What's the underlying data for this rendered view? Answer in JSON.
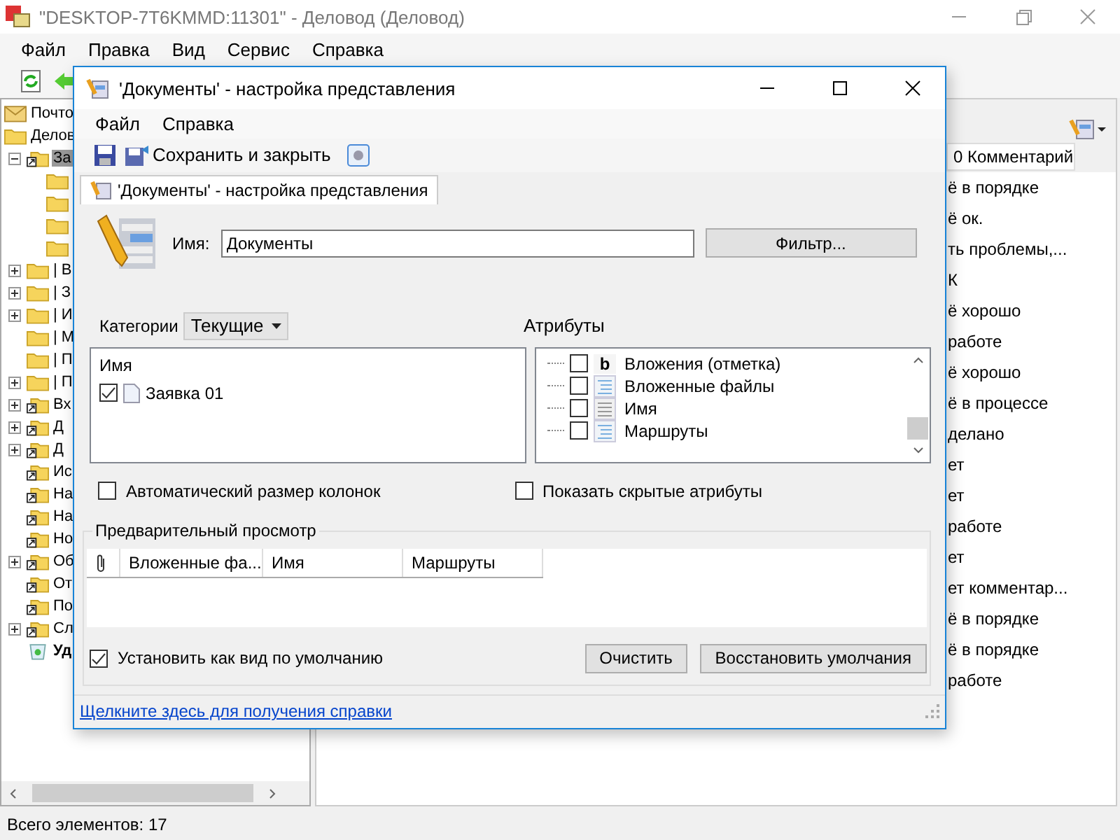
{
  "window": {
    "title": "\"DESKTOP-7T6KMMD:11301\" - Деловод (Деловод)"
  },
  "menu": [
    "Файл",
    "Правка",
    "Вид",
    "Сервис",
    "Справка"
  ],
  "tree": [
    {
      "label": "Почто",
      "kind": "mail",
      "selected": false
    },
    {
      "label": "Делов",
      "kind": "folder",
      "selected": false,
      "children": [
        {
          "label": "За",
          "kind": "shortcut",
          "selected": true,
          "expanded": true,
          "children": [
            {
              "kind": "folder"
            },
            {
              "kind": "folder"
            },
            {
              "kind": "folder"
            },
            {
              "kind": "folder"
            }
          ]
        },
        {
          "label": "| В",
          "kind": "folder",
          "selected": false,
          "expanded": false
        },
        {
          "label": "| З",
          "kind": "folder",
          "selected": false,
          "expanded": false
        },
        {
          "label": "| И",
          "kind": "folder",
          "selected": false,
          "expanded": false
        },
        {
          "label": "| М",
          "kind": "folder",
          "selected": false
        },
        {
          "label": "| П",
          "kind": "folder",
          "selected": false
        },
        {
          "label": "| П",
          "kind": "folder",
          "selected": false,
          "expanded": false
        },
        {
          "label": "Вх",
          "kind": "shortcut",
          "selected": false,
          "expanded": false
        },
        {
          "label": "Д",
          "kind": "shortcut",
          "selected": false,
          "expanded": false
        },
        {
          "label": "Д",
          "kind": "shortcut",
          "selected": false,
          "expanded": false
        },
        {
          "label": "Ис",
          "kind": "shortcut",
          "selected": false
        },
        {
          "label": "На",
          "kind": "shortcut",
          "selected": false
        },
        {
          "label": "На",
          "kind": "shortcut",
          "selected": false
        },
        {
          "label": "Но",
          "kind": "shortcut",
          "selected": false
        },
        {
          "label": "Об",
          "kind": "shortcut",
          "selected": false,
          "expanded": false
        },
        {
          "label": "От",
          "kind": "shortcut",
          "selected": false
        },
        {
          "label": "По",
          "kind": "shortcut",
          "selected": false
        },
        {
          "label": "Сл",
          "kind": "shortcut",
          "selected": false,
          "expanded": false
        },
        {
          "label": "Уд",
          "kind": "trash",
          "selected": false,
          "bold": true
        }
      ]
    }
  ],
  "list": {
    "column": "0 Комментарий",
    "rows": [
      "ё в порядке",
      "ё ок.",
      "ть проблемы,...",
      "К",
      "ё хорошо",
      "работе",
      "ё хорошо",
      "ё в процессе",
      "делано",
      "ет",
      "ет",
      "работе",
      "ет",
      "ет комментар...",
      "ё в порядке",
      "ё в порядке",
      "работе"
    ]
  },
  "status_bar": "Всего элементов: 17",
  "dialog": {
    "title": "'Документы' - настройка представления",
    "menu": [
      "Файл",
      "Справка"
    ],
    "save_close": "Сохранить и закрыть",
    "tab": {
      "label": "'Документы' - настройка представления",
      "selected": true
    },
    "name_label": "Имя:",
    "name_value": "Документы",
    "filter_button": "Фильтр...",
    "categories_label": "Категории",
    "categories_value": "Текущие",
    "attributes_label": "Атрибуты",
    "columns_list": {
      "header": "Имя",
      "items": [
        {
          "label": "Заявка 01",
          "checked": true
        }
      ]
    },
    "attributes": [
      {
        "label": "Вложения (отметка)",
        "checked": false,
        "kind": "glyph",
        "glyph": "b"
      },
      {
        "label": "Вложенные файлы",
        "checked": false,
        "kind": "list"
      },
      {
        "label": "Имя",
        "checked": false,
        "kind": "field"
      },
      {
        "label": "Маршруты",
        "checked": false,
        "kind": "list"
      }
    ],
    "auto_size": {
      "label": "Автоматический размер колонок",
      "checked": false
    },
    "show_hidden": {
      "label": "Показать скрытые атрибуты",
      "checked": false
    },
    "preview": {
      "title": "Предварительный просмотр",
      "columns": [
        {
          "kind": "attachment"
        },
        {
          "kind": "text",
          "label": "Вложенные фа..."
        },
        {
          "kind": "text",
          "label": "Имя"
        },
        {
          "kind": "text",
          "label": "Маршруты"
        }
      ]
    },
    "set_default": {
      "label": "Установить как вид по умолчанию",
      "checked": true
    },
    "buttons": [
      "Очистить",
      "Восстановить умолчания"
    ],
    "help_link": "Щелкните здесь для получения справки"
  }
}
